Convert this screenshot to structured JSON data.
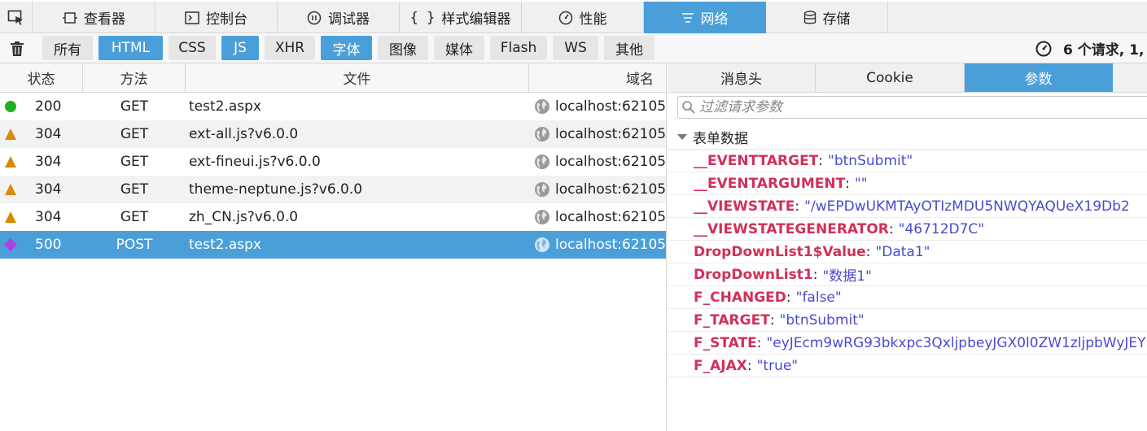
{
  "toolbox": {
    "tabs": [
      {
        "label": "查看器",
        "icon": "inspector-icon"
      },
      {
        "label": "控制台",
        "icon": "console-icon"
      },
      {
        "label": "调试器",
        "icon": "debugger-icon"
      },
      {
        "label": "样式编辑器",
        "icon": "style-editor-icon"
      },
      {
        "label": "性能",
        "icon": "performance-icon"
      },
      {
        "label": "网络",
        "icon": "network-icon"
      },
      {
        "label": "存储",
        "icon": "storage-icon"
      }
    ],
    "selected_tab": "网络",
    "accent_color": "#4a9fd9"
  },
  "filters": {
    "buttons": [
      {
        "label": "所有",
        "active": false
      },
      {
        "label": "HTML",
        "active": true
      },
      {
        "label": "CSS",
        "active": false
      },
      {
        "label": "JS",
        "active": true
      },
      {
        "label": "XHR",
        "active": false
      },
      {
        "label": "字体",
        "active": true
      },
      {
        "label": "图像",
        "active": false
      },
      {
        "label": "媒体",
        "active": false
      },
      {
        "label": "Flash",
        "active": false
      },
      {
        "label": "WS",
        "active": false
      },
      {
        "label": "其他",
        "active": false
      }
    ],
    "summary": "6 个请求, 1,"
  },
  "requests": {
    "columns": {
      "status": "状态",
      "method": "方法",
      "file": "文件",
      "domain": "域名"
    },
    "rows": [
      {
        "status": "200",
        "method": "GET",
        "file": "test2.aspx",
        "domain": "localhost:62105",
        "indicator": "green-circle",
        "indicator_color": "#22b022"
      },
      {
        "status": "304",
        "method": "GET",
        "file": "ext-all.js?v6.0.0",
        "domain": "localhost:62105",
        "indicator": "orange-triangle",
        "indicator_color": "#d98a00"
      },
      {
        "status": "304",
        "method": "GET",
        "file": "ext-fineui.js?v6.0.0",
        "domain": "localhost:62105",
        "indicator": "orange-triangle",
        "indicator_color": "#d98a00"
      },
      {
        "status": "304",
        "method": "GET",
        "file": "theme-neptune.js?v6.0.0",
        "domain": "localhost:62105",
        "indicator": "orange-triangle",
        "indicator_color": "#d98a00"
      },
      {
        "status": "304",
        "method": "GET",
        "file": "zh_CN.js?v6.0.0",
        "domain": "localhost:62105",
        "indicator": "orange-triangle",
        "indicator_color": "#d98a00"
      },
      {
        "status": "500",
        "method": "POST",
        "file": "test2.aspx",
        "domain": "localhost:62105",
        "indicator": "purple-diamond",
        "indicator_color": "#b040e0",
        "selected": true
      }
    ]
  },
  "details": {
    "tabs": [
      {
        "label": "消息头",
        "selected": false
      },
      {
        "label": "Cookie",
        "selected": false
      },
      {
        "label": "参数",
        "selected": true
      }
    ],
    "filter_placeholder": "过滤请求参数",
    "section_label": "表单数据",
    "params": [
      {
        "key": "__EVENTTARGET",
        "value": "\"btnSubmit\""
      },
      {
        "key": "__EVENTARGUMENT",
        "value": "\"\""
      },
      {
        "key": "__VIEWSTATE",
        "value": "\"/wEPDwUKMTAyOTIzMDU5NWQYAQUeX19Db2"
      },
      {
        "key": "__VIEWSTATEGENERATOR",
        "value": "\"46712D7C\""
      },
      {
        "key": "DropDownList1$Value",
        "value": "\"Data1\""
      },
      {
        "key": "DropDownList1",
        "value": "\"数据1\""
      },
      {
        "key": "F_CHANGED",
        "value": "\"false\""
      },
      {
        "key": "F_TARGET",
        "value": "\"btnSubmit\""
      },
      {
        "key": "F_STATE",
        "value": "\"eyJEcm9wRG93bkxpc3QxljpbeyJGX0l0ZW1zljpbWyJEY"
      },
      {
        "key": "F_AJAX",
        "value": "\"true\""
      }
    ]
  }
}
